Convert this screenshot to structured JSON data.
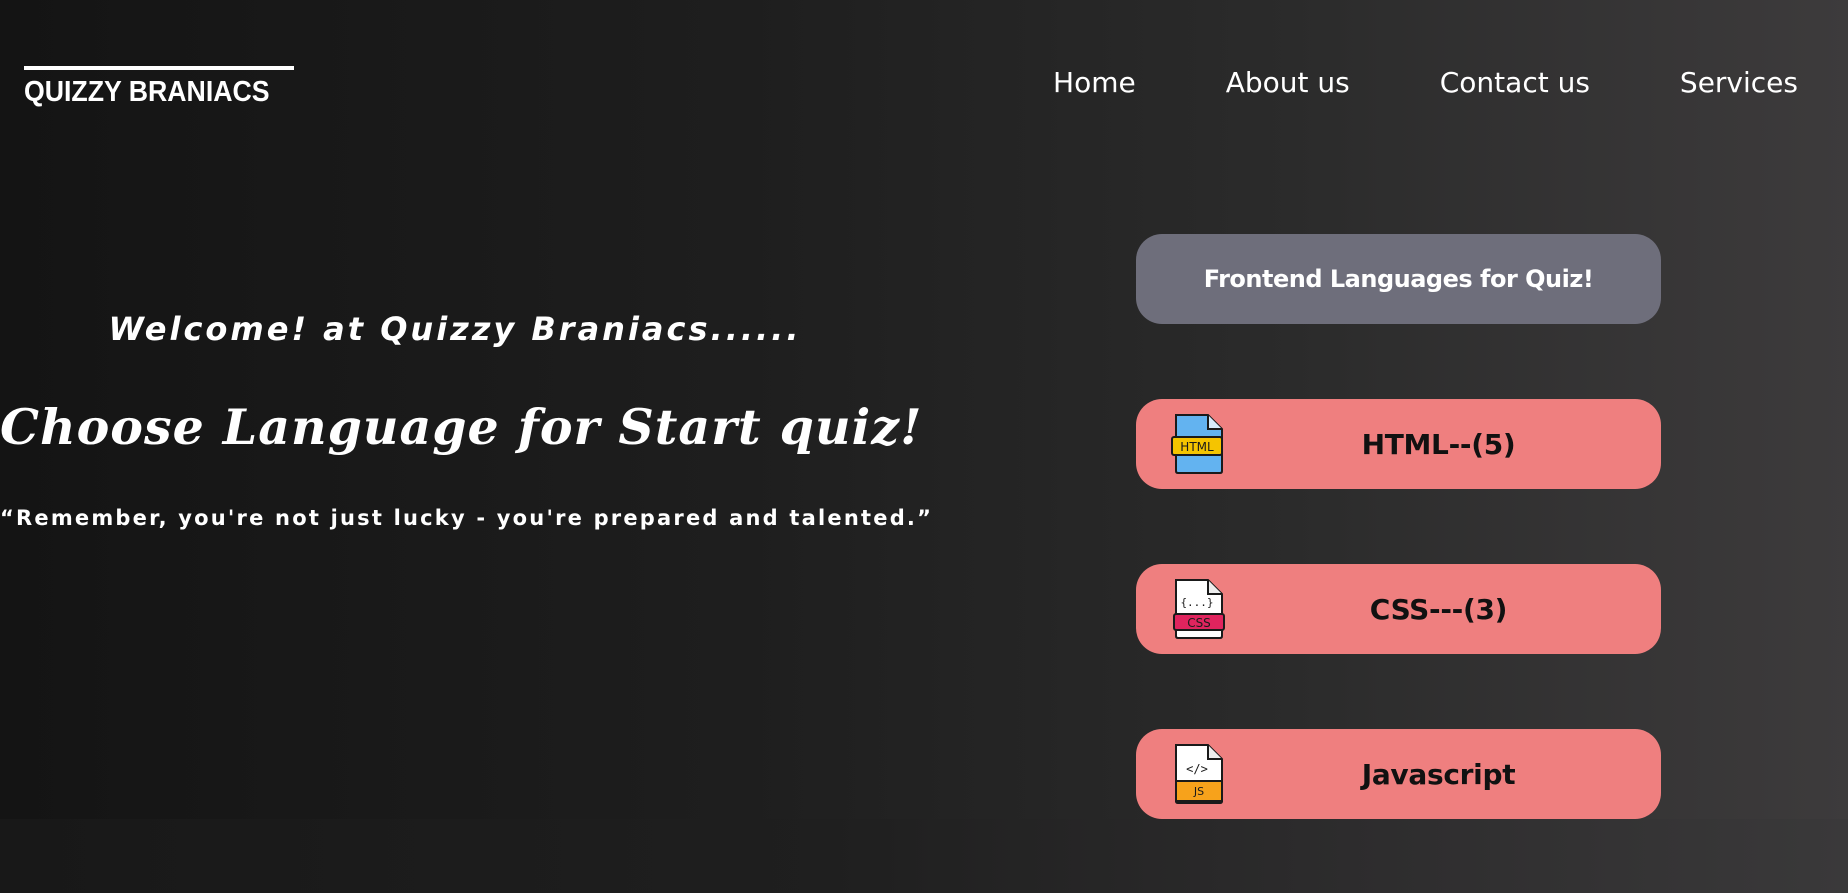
{
  "brand": {
    "logo_text": "QUIZZY BRANIACS"
  },
  "nav": {
    "items": [
      {
        "label": "Home"
      },
      {
        "label": "About us"
      },
      {
        "label": "Contact us"
      },
      {
        "label": "Services"
      }
    ]
  },
  "hero": {
    "welcome": "Welcome! at Quizzy Braniacs......",
    "heading": "Choose Language for Start quiz!",
    "quote": "“Remember, you're not just lucky - you're prepared and talented.”"
  },
  "languages": {
    "header": "Frontend Languages for Quiz!",
    "buttons": [
      {
        "label": "HTML--(5)",
        "icon": "html-file-icon"
      },
      {
        "label": "CSS---(3)",
        "icon": "css-file-icon"
      },
      {
        "label": "Javascript",
        "icon": "js-file-icon"
      }
    ]
  },
  "colors": {
    "button_bg": "#ef7f7f",
    "header_bg": "#6e6e7b",
    "text": "#ffffff"
  }
}
